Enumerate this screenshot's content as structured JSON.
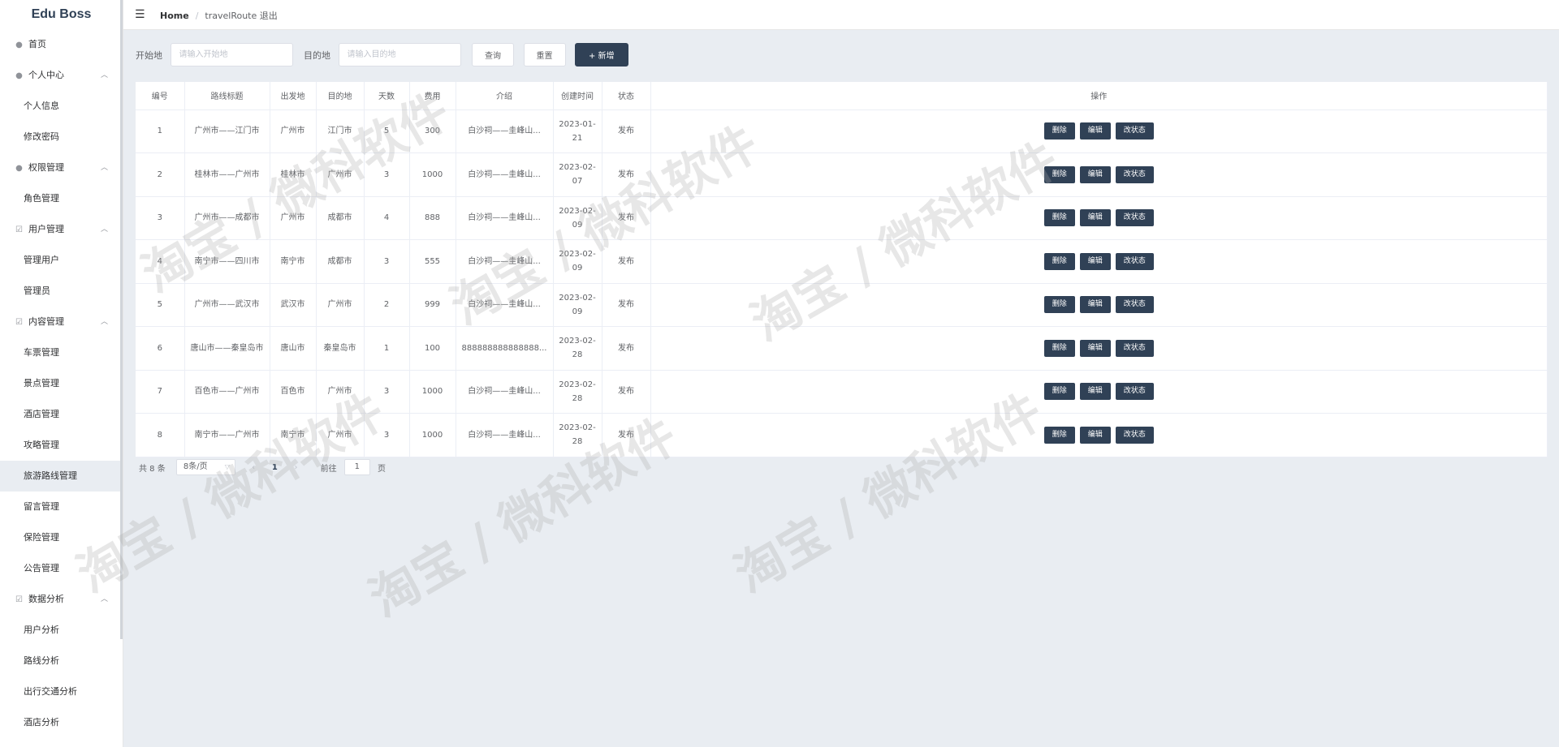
{
  "app": {
    "logo": "Edu Boss"
  },
  "header": {
    "breadcrumb_home": "Home",
    "breadcrumb_current": "travelRoute 退出"
  },
  "sidebar": {
    "items": [
      {
        "type": "group",
        "icon": "user-icon",
        "label": "首页"
      },
      {
        "type": "group",
        "icon": "user-icon",
        "label": "个人中心",
        "expanded": true
      },
      {
        "type": "sub",
        "label": "个人信息"
      },
      {
        "type": "sub",
        "label": "修改密码"
      },
      {
        "type": "group",
        "icon": "user-icon",
        "label": "权限管理",
        "expanded": true
      },
      {
        "type": "sub",
        "label": "角色管理"
      },
      {
        "type": "group",
        "icon": "check-square-icon",
        "label": "用户管理",
        "expanded": true
      },
      {
        "type": "sub",
        "label": "管理用户"
      },
      {
        "type": "sub",
        "label": "管理员"
      },
      {
        "type": "group",
        "icon": "check-square-icon",
        "label": "内容管理",
        "expanded": true
      },
      {
        "type": "sub",
        "label": "车票管理"
      },
      {
        "type": "sub",
        "label": "景点管理"
      },
      {
        "type": "sub",
        "label": "酒店管理"
      },
      {
        "type": "sub",
        "label": "攻略管理"
      },
      {
        "type": "sub",
        "label": "旅游路线管理",
        "active": true
      },
      {
        "type": "sub",
        "label": "留言管理"
      },
      {
        "type": "sub",
        "label": "保险管理"
      },
      {
        "type": "sub",
        "label": "公告管理"
      },
      {
        "type": "group",
        "icon": "check-square-icon",
        "label": "数据分析",
        "expanded": true
      },
      {
        "type": "sub",
        "label": "用户分析"
      },
      {
        "type": "sub",
        "label": "路线分析"
      },
      {
        "type": "sub",
        "label": "出行交通分析"
      },
      {
        "type": "sub",
        "label": "酒店分析"
      }
    ]
  },
  "toolbar": {
    "start_label": "开始地",
    "start_placeholder": "请输入开始地",
    "dest_label": "目的地",
    "dest_placeholder": "请输入目的地",
    "query_label": "查询",
    "reset_label": "重置",
    "add_label": "+ 新增"
  },
  "table": {
    "columns": [
      "编号",
      "路线标题",
      "出发地",
      "目的地",
      "天数",
      "费用",
      "介绍",
      "创建时间",
      "状态",
      "操作"
    ],
    "actions": [
      "删除",
      "编辑",
      "改状态"
    ],
    "rows": [
      [
        "1",
        "广州市——江门市",
        "广州市",
        "江门市",
        "5",
        "300",
        "白沙祠——圭峰山...",
        "2023-01-21",
        "发布"
      ],
      [
        "2",
        "桂林市——广州市",
        "桂林市",
        "广州市",
        "3",
        "1000",
        "白沙祠——圭峰山...",
        "2023-02-07",
        "发布"
      ],
      [
        "3",
        "广州市——成都市",
        "广州市",
        "成都市",
        "4",
        "888",
        "白沙祠——圭峰山...",
        "2023-02-09",
        "发布"
      ],
      [
        "4",
        "南宁市——四川市",
        "南宁市",
        "成都市",
        "3",
        "555",
        "白沙祠——圭峰山...",
        "2023-02-09",
        "发布"
      ],
      [
        "5",
        "广州市——武汉市",
        "武汉市",
        "广州市",
        "2",
        "999",
        "白沙祠——圭峰山...",
        "2023-02-09",
        "发布"
      ],
      [
        "6",
        "唐山市——秦皇岛市",
        "唐山市",
        "秦皇岛市",
        "1",
        "100",
        "888888888888888...",
        "2023-02-28",
        "发布"
      ],
      [
        "7",
        "百色市——广州市",
        "百色市",
        "广州市",
        "3",
        "1000",
        "白沙祠——圭峰山...",
        "2023-02-28",
        "发布"
      ],
      [
        "8",
        "南宁市——广州市",
        "南宁市",
        "广州市",
        "3",
        "1000",
        "白沙祠——圭峰山...",
        "2023-02-28",
        "发布"
      ]
    ]
  },
  "pagination": {
    "total_text": "共 8 条",
    "page_size_text": "8条/页",
    "current_page": "1",
    "jump_prefix": "前往",
    "jump_value": "1",
    "jump_suffix": "页"
  },
  "watermark": {
    "text": "淘宝 / 微科软件"
  }
}
